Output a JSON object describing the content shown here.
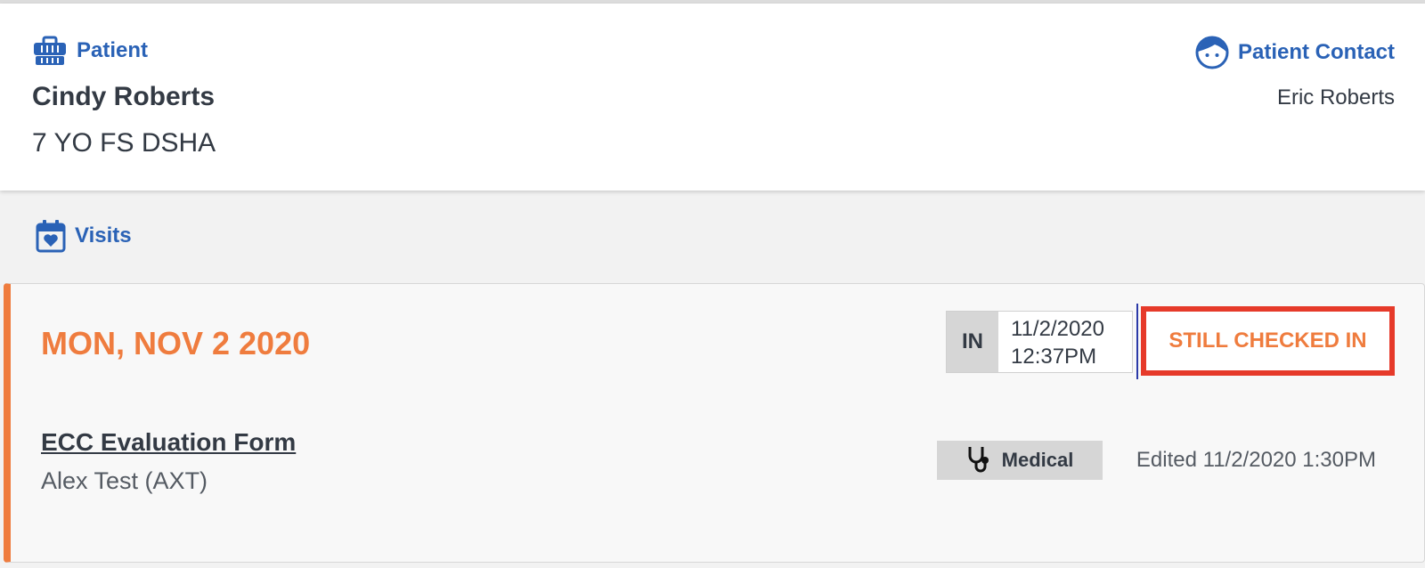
{
  "patient": {
    "heading": "Patient",
    "heading_icon": "pet-carrier-icon",
    "name": "Cindy Roberts",
    "description": "7 YO FS DSHA"
  },
  "contact": {
    "heading": "Patient Contact",
    "heading_icon": "face-icon",
    "name": "Eric Roberts"
  },
  "visits": {
    "heading": "Visits",
    "heading_icon": "calendar-heart-icon",
    "items": [
      {
        "date": "MON, NOV 2 2020",
        "checkin_label": "IN",
        "checkin_date": "11/2/2020",
        "checkin_time": "12:37PM",
        "status": "STILL CHECKED IN",
        "form_title": "ECC Evaluation Form",
        "form_author": "Alex Test (AXT)",
        "category": "Medical",
        "category_icon": "stethoscope-icon",
        "edited": "Edited 11/2/2020 1:30PM"
      }
    ]
  },
  "colors": {
    "accent_blue": "#2a62b6",
    "accent_orange": "#ef7c3e",
    "highlight_red": "#e63a2a"
  }
}
